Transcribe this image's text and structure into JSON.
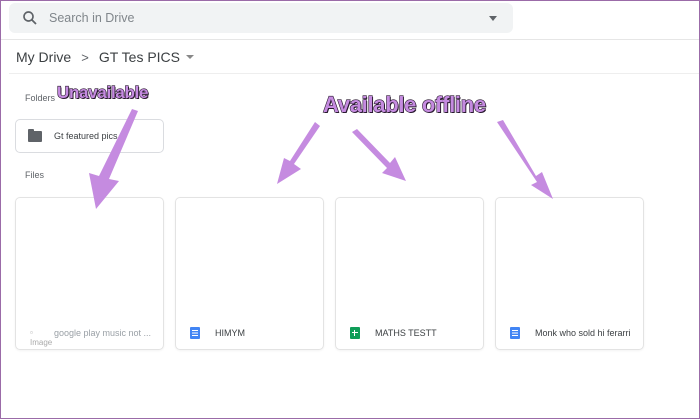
{
  "search": {
    "placeholder": "Search in Drive"
  },
  "breadcrumb": {
    "root": "My Drive",
    "current": "GT Tes PICS"
  },
  "sections": {
    "folders": "Folders",
    "files": "Files"
  },
  "folders": [
    {
      "name": "Gt featured pics"
    }
  ],
  "files": [
    {
      "name": "google play music not ...",
      "type": "image",
      "alt": "Image",
      "available_offline": false
    },
    {
      "name": "HIMYM",
      "type": "doc",
      "available_offline": true
    },
    {
      "name": "MATHS TESTT",
      "type": "sheet",
      "available_offline": true
    },
    {
      "name": "Monk who sold hi ferarri",
      "type": "doc",
      "available_offline": true
    }
  ],
  "annotations": {
    "unavailable": "Unavailable",
    "available": "Available offline",
    "color": "#c58be0"
  }
}
